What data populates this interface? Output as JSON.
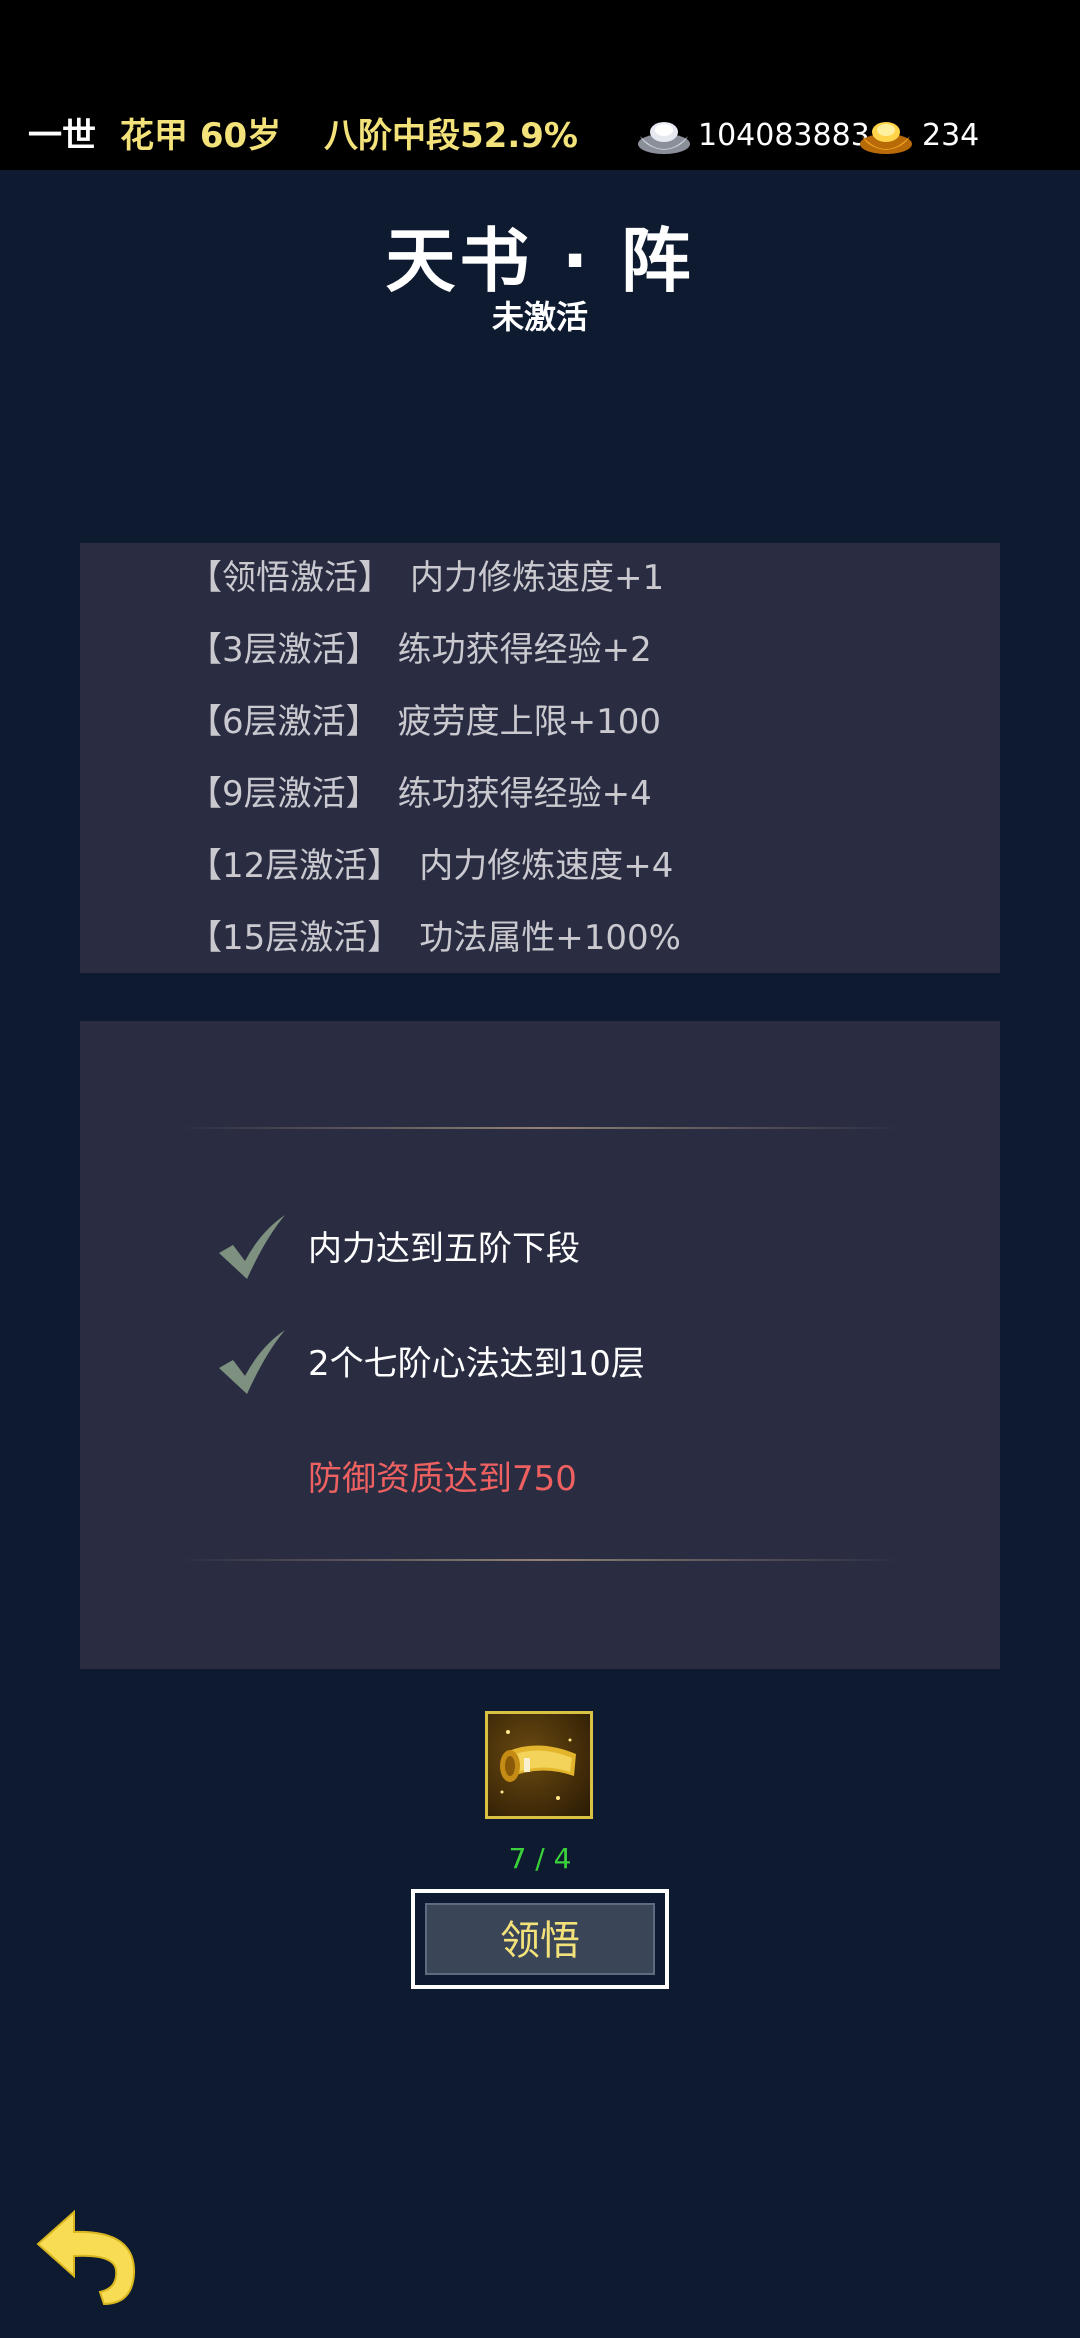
{
  "hud": {
    "life": "一世",
    "age": "花甲 60岁",
    "realm": "八阶中段52.9%",
    "silver_icon": "silver-ingot-icon",
    "silver": "104083883",
    "gold_icon": "gold-ingot-icon",
    "gold": "234"
  },
  "title": "天书 · 阵",
  "status": "未激活",
  "effects": [
    {
      "tag": "【领悟激活】",
      "bonus": "内力修炼速度+1"
    },
    {
      "tag": "【3层激活】",
      "bonus": "练功获得经验+2"
    },
    {
      "tag": "【6层激活】",
      "bonus": "疲劳度上限+100"
    },
    {
      "tag": "【9层激活】",
      "bonus": "练功获得经验+4"
    },
    {
      "tag": "【12层激活】",
      "bonus": "内力修炼速度+4"
    },
    {
      "tag": "【15层激活】",
      "bonus": "功法属性+100%"
    }
  ],
  "requirements": [
    {
      "text": "内力达到五阶下段",
      "met": true
    },
    {
      "text": "2个七阶心法达到10层",
      "met": true
    },
    {
      "text": "防御资质达到750",
      "met": false
    }
  ],
  "item": {
    "icon": "golden-scroll-icon",
    "count": "7 / 4"
  },
  "button": {
    "label": "领悟"
  },
  "back_icon": "back-arrow-icon",
  "colors": {
    "background": "#0e1a2f",
    "panel": "#2a2d42",
    "accent_yellow": "#f3e27a",
    "unmet_red": "#ef6161",
    "count_green": "#3ad13a"
  }
}
